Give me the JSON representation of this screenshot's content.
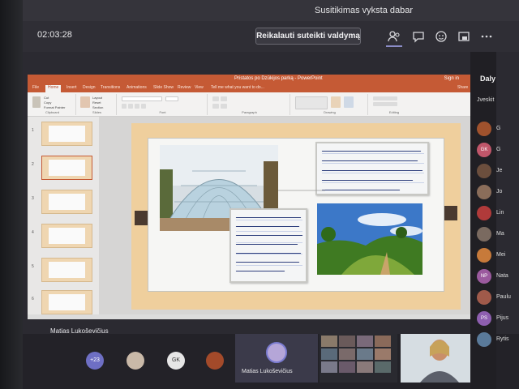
{
  "teams": {
    "header_title": "Susitikimas vyksta dabar",
    "timer": "02:03:28",
    "request_control_label": "Reikalauti suteikti valdymą",
    "controls": [
      "people-icon",
      "chat-icon",
      "reactions-icon",
      "share-icon",
      "more-icon"
    ]
  },
  "ppt": {
    "window_title": "Pristatos po Dzūkijos parką - PowerPoint",
    "sign_in": "Sign in",
    "share_label": "Share",
    "tabs": [
      "File",
      "Home",
      "Insert",
      "Design",
      "Transitions",
      "Animations",
      "Slide Show",
      "Review",
      "View",
      "Tell me what you want to do..."
    ],
    "ribbon_groups": [
      "Clipboard",
      "Slides",
      "Font",
      "Paragraph",
      "Drawing",
      "Editing"
    ],
    "clipboard_items": [
      "Cut",
      "Copy",
      "Format Painter"
    ],
    "slides_items": [
      "New Slide",
      "Layout",
      "Reset",
      "Section"
    ],
    "slide_numbers": [
      "1",
      "2",
      "3",
      "4",
      "5",
      "6"
    ]
  },
  "presenter_name": "Matias Lukoševičius",
  "participants": {
    "overflow": "+23",
    "initials_gk": "GK",
    "tile_name": "Matias Lukoševičius"
  },
  "panel": {
    "title": "Daly",
    "search_fragment": "Jveskit",
    "people": [
      {
        "initials": "",
        "name": "G",
        "color": "#a0522d"
      },
      {
        "initials": "GK",
        "name": "G",
        "color": "#c0566a"
      },
      {
        "initials": "",
        "name": "Je",
        "color": "#6b4e3d"
      },
      {
        "initials": "",
        "name": "Jo",
        "color": "#8a6d5a"
      },
      {
        "initials": "",
        "name": "Lin",
        "color": "#b03a3a"
      },
      {
        "initials": "",
        "name": "Ma",
        "color": "#7a6a60"
      },
      {
        "initials": "",
        "name": "Mei",
        "color": "#c77a3a"
      },
      {
        "initials": "NP",
        "name": "Nata",
        "color": "#9b5a9e"
      },
      {
        "initials": "",
        "name": "Paulu",
        "color": "#a05a4a"
      },
      {
        "initials": "PS",
        "name": "Pijus",
        "color": "#8e5fb0"
      },
      {
        "initials": "",
        "name": "Rytis",
        "color": "#5a7a9a"
      }
    ]
  },
  "colors": {
    "ppt_accent": "#c55a35",
    "teams_purple": "#8b8cc7",
    "slide_bg": "#efcf9d"
  }
}
